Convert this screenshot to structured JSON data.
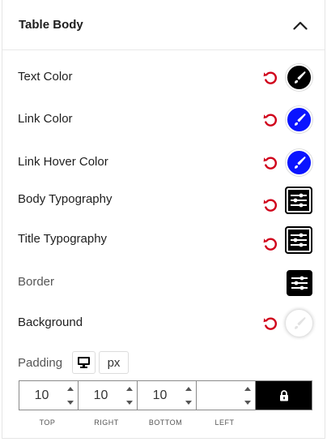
{
  "section": {
    "title": "Table Body",
    "collapse_icon": "chevron-up-icon"
  },
  "rows": {
    "text_color": {
      "label": "Text Color",
      "swatch": "#000000"
    },
    "link_color": {
      "label": "Link Color",
      "swatch": "#0a14ff"
    },
    "link_hover_color": {
      "label": "Link Hover Color",
      "swatch": "#0a14ff"
    },
    "body_typography": {
      "label": "Body Typography"
    },
    "title_typography": {
      "label": "Title Typography"
    },
    "border": {
      "label": "Border"
    },
    "background": {
      "label": "Background",
      "swatch": "#ffffff"
    }
  },
  "padding": {
    "label": "Padding",
    "device_icon": "desktop-icon",
    "unit": "px",
    "top": {
      "value": "10",
      "label": "TOP"
    },
    "right": {
      "value": "10",
      "label": "RIGHT"
    },
    "bottom": {
      "value": "10",
      "label": "BOTTOM"
    },
    "left": {
      "value": "",
      "label": "LEFT"
    },
    "lock_icon": "lock-icon"
  },
  "colors": {
    "reset": "#d0021b",
    "accent": "#0a14ff"
  }
}
